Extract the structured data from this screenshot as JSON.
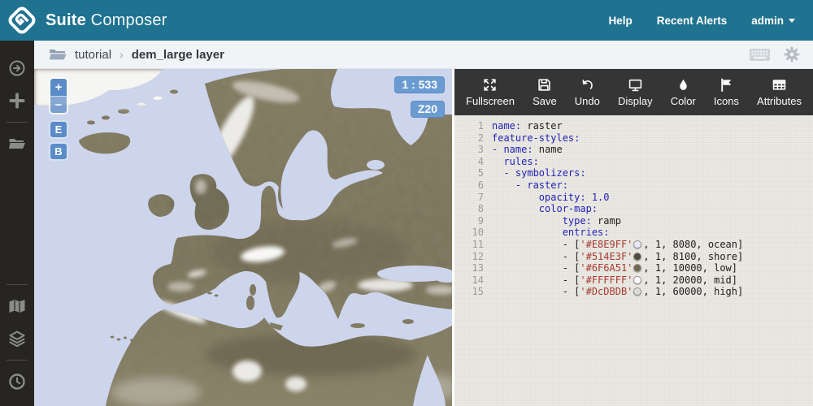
{
  "header": {
    "brand_bold": "Suite",
    "brand_light": "Composer",
    "nav": [
      {
        "label": "Help",
        "caret": false
      },
      {
        "label": "Recent Alerts",
        "caret": false
      },
      {
        "label": "admin",
        "caret": true
      }
    ]
  },
  "breadcrumb": {
    "parent": "tutorial",
    "separator": "›",
    "current": "dem_large layer"
  },
  "sidebar": {
    "items": [
      {
        "icon": "arrow-circle-right-icon"
      },
      {
        "icon": "plus-icon"
      },
      {
        "divider": true
      },
      {
        "icon": "folder-open-icon"
      },
      {
        "spacer": true
      },
      {
        "divider": true
      },
      {
        "icon": "map-icon"
      },
      {
        "icon": "layers-icon"
      },
      {
        "divider": true
      },
      {
        "icon": "clock-icon"
      }
    ]
  },
  "map": {
    "scale_badge": "1 : 533",
    "zoom_badge": "Z20",
    "zoom_in_label": "+",
    "zoom_out_label": "−",
    "edit_button": "E",
    "base_button": "B",
    "ocean_color": "#cdd5ec",
    "land_color": "#7d755c",
    "control_color": "#5b8cc8"
  },
  "toolbar": {
    "buttons": [
      {
        "label": "Fullscreen",
        "icon": "fullscreen-icon"
      },
      {
        "label": "Save",
        "icon": "save-icon"
      },
      {
        "label": "Undo",
        "icon": "undo-icon"
      },
      {
        "label": "Display",
        "icon": "display-icon"
      },
      {
        "label": "Color",
        "icon": "color-icon"
      },
      {
        "label": "Icons",
        "icon": "flag-icon"
      },
      {
        "label": "Attributes",
        "icon": "attributes-icon"
      }
    ]
  },
  "editor": {
    "token_colors": {
      "key": "#2123b8",
      "string": "#a63a2e",
      "number": "#2123b8",
      "plain": "#1c1c1c"
    },
    "lines": [
      {
        "num": 1,
        "segments": [
          {
            "t": "name:",
            "c": "key"
          },
          {
            "t": " raster",
            "c": "plain"
          }
        ]
      },
      {
        "num": 2,
        "segments": [
          {
            "t": "feature-styles:",
            "c": "key"
          }
        ]
      },
      {
        "num": 3,
        "segments": [
          {
            "t": "- name:",
            "c": "key"
          },
          {
            "t": " name",
            "c": "plain"
          }
        ]
      },
      {
        "num": 4,
        "segments": [
          {
            "t": "  ",
            "c": "plain"
          },
          {
            "t": "rules:",
            "c": "key"
          }
        ]
      },
      {
        "num": 5,
        "segments": [
          {
            "t": "  ",
            "c": "plain"
          },
          {
            "t": "- symbolizers:",
            "c": "key"
          }
        ]
      },
      {
        "num": 6,
        "segments": [
          {
            "t": "    ",
            "c": "plain"
          },
          {
            "t": "- raster:",
            "c": "key"
          }
        ]
      },
      {
        "num": 7,
        "segments": [
          {
            "t": "        ",
            "c": "plain"
          },
          {
            "t": "opacity:",
            "c": "key"
          },
          {
            "t": " 1.0",
            "c": "num"
          }
        ]
      },
      {
        "num": 8,
        "segments": [
          {
            "t": "        ",
            "c": "plain"
          },
          {
            "t": "color-map:",
            "c": "key"
          }
        ]
      },
      {
        "num": 9,
        "segments": [
          {
            "t": "            ",
            "c": "plain"
          },
          {
            "t": "type:",
            "c": "key"
          },
          {
            "t": " ramp",
            "c": "plain"
          }
        ]
      },
      {
        "num": 10,
        "segments": [
          {
            "t": "            ",
            "c": "plain"
          },
          {
            "t": "entries:",
            "c": "key"
          }
        ]
      },
      {
        "num": 11,
        "segments": [
          {
            "t": "            - [",
            "c": "plain"
          },
          {
            "t": "'#E8E9FF'",
            "c": "str"
          },
          {
            "swatch": "#E8E9FF"
          },
          {
            "t": ", 1, 8080, ocean]",
            "c": "plain"
          }
        ]
      },
      {
        "num": 12,
        "segments": [
          {
            "t": "            - [",
            "c": "plain"
          },
          {
            "t": "'#514E3F'",
            "c": "str"
          },
          {
            "swatch": "#514E3F"
          },
          {
            "t": ", 1, 8100, shore]",
            "c": "plain"
          }
        ]
      },
      {
        "num": 13,
        "segments": [
          {
            "t": "            - [",
            "c": "plain"
          },
          {
            "t": "'#6F6A51'",
            "c": "str"
          },
          {
            "swatch": "#6F6A51"
          },
          {
            "t": ", 1, 10000, low]",
            "c": "plain"
          }
        ]
      },
      {
        "num": 14,
        "segments": [
          {
            "t": "            - [",
            "c": "plain"
          },
          {
            "t": "'#FFFFFF'",
            "c": "str"
          },
          {
            "swatch": "#FFFFFF"
          },
          {
            "t": ", 1, 20000, mid]",
            "c": "plain"
          }
        ]
      },
      {
        "num": 15,
        "segments": [
          {
            "t": "            - [",
            "c": "plain"
          },
          {
            "t": "'#DcDBDB'",
            "c": "str"
          },
          {
            "swatch": "#DCDBDB"
          },
          {
            "t": ", 1, 60000, high]",
            "c": "plain"
          }
        ]
      }
    ]
  }
}
